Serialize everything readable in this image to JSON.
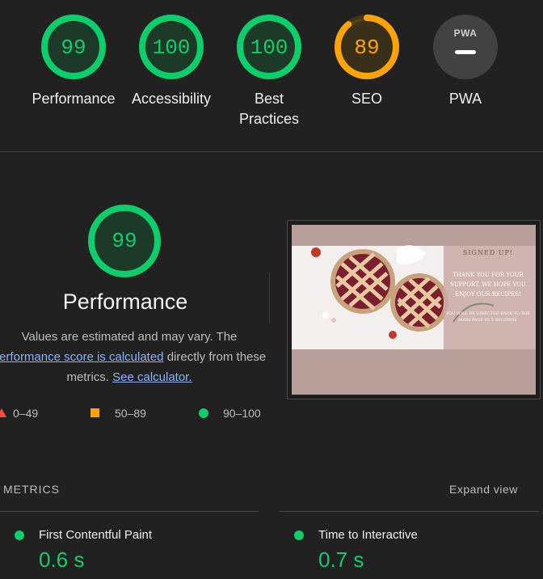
{
  "colors": {
    "pass": "#0cce6b",
    "average": "#ffa400",
    "fail": "#ff4e42",
    "na": "#9e9e9e"
  },
  "gauges": [
    {
      "label": "Performance",
      "score": "99",
      "fraction": 0.99,
      "status": "pass"
    },
    {
      "label": "Accessibility",
      "score": "100",
      "fraction": 1.0,
      "status": "pass"
    },
    {
      "label": "Best\nPractices",
      "score": "100",
      "fraction": 1.0,
      "status": "pass"
    },
    {
      "label": "SEO",
      "score": "89",
      "fraction": 0.89,
      "status": "average"
    },
    {
      "label": "PWA",
      "score": "",
      "fraction": 0,
      "status": "na",
      "badge": "PWA"
    }
  ],
  "performance": {
    "score": "99",
    "fraction": 0.99,
    "title": "Performance",
    "desc_prefix": "Values are estimated and may vary. The",
    "link_score": "performance score is calculated",
    "desc_middle": "directly from these",
    "desc_metrics": "metrics.",
    "link_calculator": "See calculator."
  },
  "legend": {
    "fail": "0–49",
    "average": "50–89",
    "pass": "90–100"
  },
  "screenshot": {
    "heading": "SIGNED UP!",
    "body": "THANK YOU FOR YOUR SUPPORT. WE HOPE YOU ENJOY OUR RECIPES!",
    "footer": "YOU WILL BE DIRECTED BACK TO THE MAIN PAGE IN 5 SECONDS."
  },
  "metrics": {
    "header": "METRICS",
    "expand": "Expand view",
    "items": [
      {
        "title": "First Contentful Paint",
        "value": "0.6 s"
      },
      {
        "title": "Time to Interactive",
        "value": "0.7 s"
      }
    ]
  }
}
